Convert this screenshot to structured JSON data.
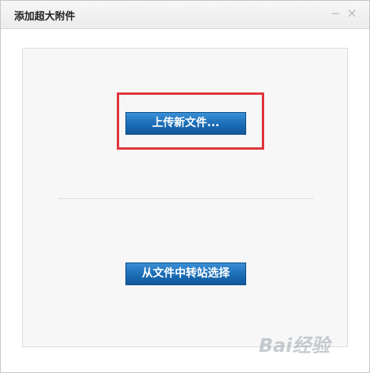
{
  "window": {
    "title": "添加超大附件",
    "minimize_glyph": "−",
    "close_glyph": "×"
  },
  "actions": {
    "upload_label": "上传新文件...",
    "transfer_label": "从文件中转站选择"
  },
  "watermark": {
    "text": "Bai经验"
  },
  "colors": {
    "button_blue": "#1a6cb5",
    "highlight_red": "#e0353a"
  }
}
